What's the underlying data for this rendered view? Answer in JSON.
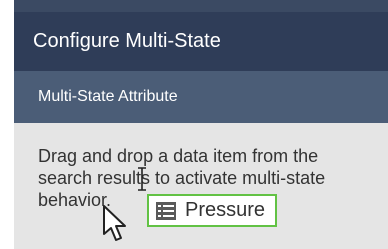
{
  "panel": {
    "title": "Configure Multi-State",
    "section_title": "Multi-State Attribute",
    "instruction_lines": [
      "Drag and drop a data item from the",
      "search results to activate multi-state",
      "behavior."
    ]
  },
  "drag_item": {
    "label": "Pressure",
    "icon": "list-icon"
  },
  "colors": {
    "header_bg": "#2f3d58",
    "subheader_bg": "#4b5d77",
    "panel_bg": "#e5e5e5",
    "drag_outline": "#62c244"
  }
}
